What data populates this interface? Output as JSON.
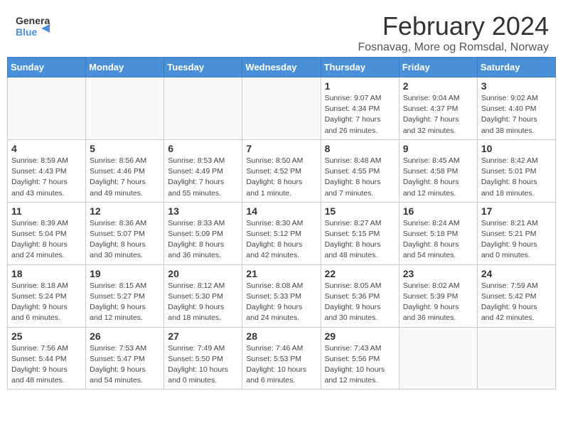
{
  "logo": {
    "line1": "General",
    "line2": "Blue"
  },
  "title": "February 2024",
  "subtitle": "Fosnavag, More og Romsdal, Norway",
  "weekdays": [
    "Sunday",
    "Monday",
    "Tuesday",
    "Wednesday",
    "Thursday",
    "Friday",
    "Saturday"
  ],
  "weeks": [
    [
      {
        "day": "",
        "info": ""
      },
      {
        "day": "",
        "info": ""
      },
      {
        "day": "",
        "info": ""
      },
      {
        "day": "",
        "info": ""
      },
      {
        "day": "1",
        "info": "Sunrise: 9:07 AM\nSunset: 4:34 PM\nDaylight: 7 hours\nand 26 minutes."
      },
      {
        "day": "2",
        "info": "Sunrise: 9:04 AM\nSunset: 4:37 PM\nDaylight: 7 hours\nand 32 minutes."
      },
      {
        "day": "3",
        "info": "Sunrise: 9:02 AM\nSunset: 4:40 PM\nDaylight: 7 hours\nand 38 minutes."
      }
    ],
    [
      {
        "day": "4",
        "info": "Sunrise: 8:59 AM\nSunset: 4:43 PM\nDaylight: 7 hours\nand 43 minutes."
      },
      {
        "day": "5",
        "info": "Sunrise: 8:56 AM\nSunset: 4:46 PM\nDaylight: 7 hours\nand 49 minutes."
      },
      {
        "day": "6",
        "info": "Sunrise: 8:53 AM\nSunset: 4:49 PM\nDaylight: 7 hours\nand 55 minutes."
      },
      {
        "day": "7",
        "info": "Sunrise: 8:50 AM\nSunset: 4:52 PM\nDaylight: 8 hours\nand 1 minute."
      },
      {
        "day": "8",
        "info": "Sunrise: 8:48 AM\nSunset: 4:55 PM\nDaylight: 8 hours\nand 7 minutes."
      },
      {
        "day": "9",
        "info": "Sunrise: 8:45 AM\nSunset: 4:58 PM\nDaylight: 8 hours\nand 12 minutes."
      },
      {
        "day": "10",
        "info": "Sunrise: 8:42 AM\nSunset: 5:01 PM\nDaylight: 8 hours\nand 18 minutes."
      }
    ],
    [
      {
        "day": "11",
        "info": "Sunrise: 8:39 AM\nSunset: 5:04 PM\nDaylight: 8 hours\nand 24 minutes."
      },
      {
        "day": "12",
        "info": "Sunrise: 8:36 AM\nSunset: 5:07 PM\nDaylight: 8 hours\nand 30 minutes."
      },
      {
        "day": "13",
        "info": "Sunrise: 8:33 AM\nSunset: 5:09 PM\nDaylight: 8 hours\nand 36 minutes."
      },
      {
        "day": "14",
        "info": "Sunrise: 8:30 AM\nSunset: 5:12 PM\nDaylight: 8 hours\nand 42 minutes."
      },
      {
        "day": "15",
        "info": "Sunrise: 8:27 AM\nSunset: 5:15 PM\nDaylight: 8 hours\nand 48 minutes."
      },
      {
        "day": "16",
        "info": "Sunrise: 8:24 AM\nSunset: 5:18 PM\nDaylight: 8 hours\nand 54 minutes."
      },
      {
        "day": "17",
        "info": "Sunrise: 8:21 AM\nSunset: 5:21 PM\nDaylight: 9 hours\nand 0 minutes."
      }
    ],
    [
      {
        "day": "18",
        "info": "Sunrise: 8:18 AM\nSunset: 5:24 PM\nDaylight: 9 hours\nand 6 minutes."
      },
      {
        "day": "19",
        "info": "Sunrise: 8:15 AM\nSunset: 5:27 PM\nDaylight: 9 hours\nand 12 minutes."
      },
      {
        "day": "20",
        "info": "Sunrise: 8:12 AM\nSunset: 5:30 PM\nDaylight: 9 hours\nand 18 minutes."
      },
      {
        "day": "21",
        "info": "Sunrise: 8:08 AM\nSunset: 5:33 PM\nDaylight: 9 hours\nand 24 minutes."
      },
      {
        "day": "22",
        "info": "Sunrise: 8:05 AM\nSunset: 5:36 PM\nDaylight: 9 hours\nand 30 minutes."
      },
      {
        "day": "23",
        "info": "Sunrise: 8:02 AM\nSunset: 5:39 PM\nDaylight: 9 hours\nand 36 minutes."
      },
      {
        "day": "24",
        "info": "Sunrise: 7:59 AM\nSunset: 5:42 PM\nDaylight: 9 hours\nand 42 minutes."
      }
    ],
    [
      {
        "day": "25",
        "info": "Sunrise: 7:56 AM\nSunset: 5:44 PM\nDaylight: 9 hours\nand 48 minutes."
      },
      {
        "day": "26",
        "info": "Sunrise: 7:53 AM\nSunset: 5:47 PM\nDaylight: 9 hours\nand 54 minutes."
      },
      {
        "day": "27",
        "info": "Sunrise: 7:49 AM\nSunset: 5:50 PM\nDaylight: 10 hours\nand 0 minutes."
      },
      {
        "day": "28",
        "info": "Sunrise: 7:46 AM\nSunset: 5:53 PM\nDaylight: 10 hours\nand 6 minutes."
      },
      {
        "day": "29",
        "info": "Sunrise: 7:43 AM\nSunset: 5:56 PM\nDaylight: 10 hours\nand 12 minutes."
      },
      {
        "day": "",
        "info": ""
      },
      {
        "day": "",
        "info": ""
      }
    ]
  ]
}
